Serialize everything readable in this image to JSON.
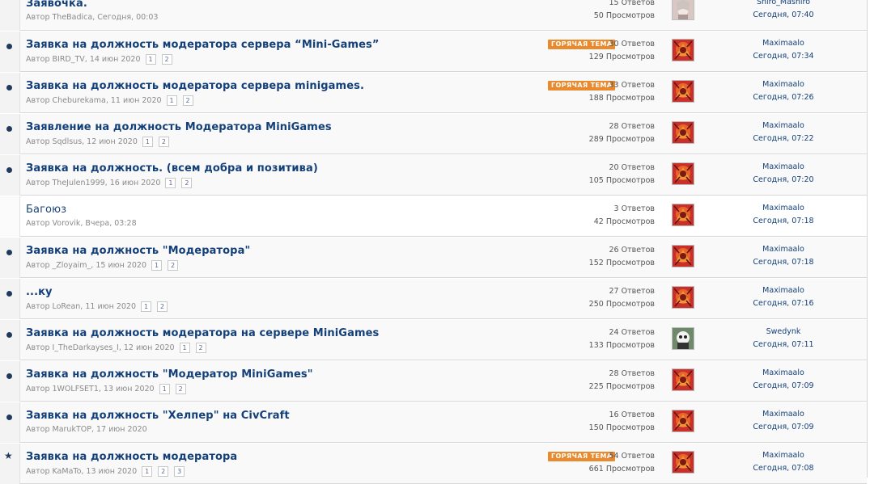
{
  "threads": [
    {
      "title": "Заявочка.",
      "author": "Автор TheBadica, Сегодня, 00:03",
      "pages": [],
      "hot": false,
      "replies": "15 Ответов",
      "views": "50 Просмотров",
      "last_user": "Shiro_Mashiro",
      "last_time": "Сегодня, 07:40",
      "status_icon": "none",
      "avatar": "avatar-grey"
    },
    {
      "title": "Заявка на должность модератора сервера “Mini-Games”",
      "author": "Автор BIRD_TV, 14 июн 2020",
      "pages": [
        "1",
        "2"
      ],
      "hot": true,
      "replies": "30 Ответов",
      "views": "129 Просмотров",
      "last_user": "Maximaalo",
      "last_time": "Сегодня, 07:34",
      "status_icon": "unread-dot",
      "avatar": "avatar-dragon"
    },
    {
      "title": "Заявка на должность модератора сервера minigames.",
      "author": "Автор Cheburekama, 11 июн 2020",
      "pages": [
        "1",
        "2"
      ],
      "hot": true,
      "replies": "33 Ответов",
      "views": "188 Просмотров",
      "last_user": "Maximaalo",
      "last_time": "Сегодня, 07:26",
      "status_icon": "unread-dot",
      "avatar": "avatar-dragon"
    },
    {
      "title": "Заявление на должность Модератора MiniGames",
      "author": "Автор Sqdlsus, 12 июн 2020",
      "pages": [
        "1",
        "2"
      ],
      "hot": false,
      "replies": "28 Ответов",
      "views": "289 Просмотров",
      "last_user": "Maximaalo",
      "last_time": "Сегодня, 07:22",
      "status_icon": "unread-dot",
      "avatar": "avatar-dragon"
    },
    {
      "title": "Заявка на должность. (всем добра и позитива)",
      "author": "Автор TheJulen1999, 16 июн 2020",
      "pages": [
        "1",
        "2"
      ],
      "hot": false,
      "replies": "20 Ответов",
      "views": "105 Просмотров",
      "last_user": "Maximaalo",
      "last_time": "Сегодня, 07:20",
      "status_icon": "unread-dot",
      "avatar": "avatar-dragon"
    },
    {
      "title": "Багоюз",
      "author": "Автор Vorovik, Вчера, 03:28",
      "pages": [],
      "hot": false,
      "replies": "3 Ответов",
      "views": "42 Просмотров",
      "last_user": "Maximaalo",
      "last_time": "Сегодня, 07:18",
      "status_icon": "read",
      "avatar": "avatar-dragon"
    },
    {
      "title": "Заявка на должность \"Модератора\"",
      "author": "Автор _Zloyaim_, 15 июн 2020",
      "pages": [
        "1",
        "2"
      ],
      "hot": false,
      "replies": "26 Ответов",
      "views": "152 Просмотров",
      "last_user": "Maximaalo",
      "last_time": "Сегодня, 07:18",
      "status_icon": "unread-dot",
      "avatar": "avatar-dragon"
    },
    {
      "title": "...ку",
      "author": "Автор LoRean, 11 июн 2020",
      "pages": [
        "1",
        "2"
      ],
      "hot": false,
      "replies": "27 Ответов",
      "views": "250 Просмотров",
      "last_user": "Maximaalo",
      "last_time": "Сегодня, 07:16",
      "status_icon": "unread-dot",
      "avatar": "avatar-dragon"
    },
    {
      "title": "Заявка на должность модератора на сервере MiniGames",
      "author": "Автор I_TheDarkayses_I, 12 июн 2020",
      "pages": [
        "1",
        "2"
      ],
      "hot": false,
      "replies": "24 Ответов",
      "views": "133 Просмотров",
      "last_user": "Swedynk",
      "last_time": "Сегодня, 07:11",
      "status_icon": "unread-dot",
      "avatar": "avatar-panda"
    },
    {
      "title": "Заявка на должность \"Модератор MiniGames\"",
      "author": "Автор 1WOLFSET1, 13 июн 2020",
      "pages": [
        "1",
        "2"
      ],
      "hot": false,
      "replies": "28 Ответов",
      "views": "225 Просмотров",
      "last_user": "Maximaalo",
      "last_time": "Сегодня, 07:09",
      "status_icon": "unread-dot",
      "avatar": "avatar-dragon"
    },
    {
      "title": "Заявка на должность \"Хелпер\" на CivCraft",
      "author": "Автор MarukTOP, 17 июн 2020",
      "pages": [],
      "hot": false,
      "replies": "16 Ответов",
      "views": "150 Просмотров",
      "last_user": "Maximaalo",
      "last_time": "Сегодня, 07:09",
      "status_icon": "unread-dot",
      "avatar": "avatar-dragon"
    },
    {
      "title": "Заявка на должность модератора",
      "author": "Автор KaMaTo, 13 июн 2020",
      "pages": [
        "1",
        "2",
        "3"
      ],
      "hot": true,
      "replies": "54 Ответов",
      "views": "661 Просмотров",
      "last_user": "Maximaalo",
      "last_time": "Сегодня, 07:08",
      "status_icon": "star",
      "avatar": "avatar-dragon"
    }
  ],
  "hot_label": "ГОРЯЧАЯ ТЕМА"
}
